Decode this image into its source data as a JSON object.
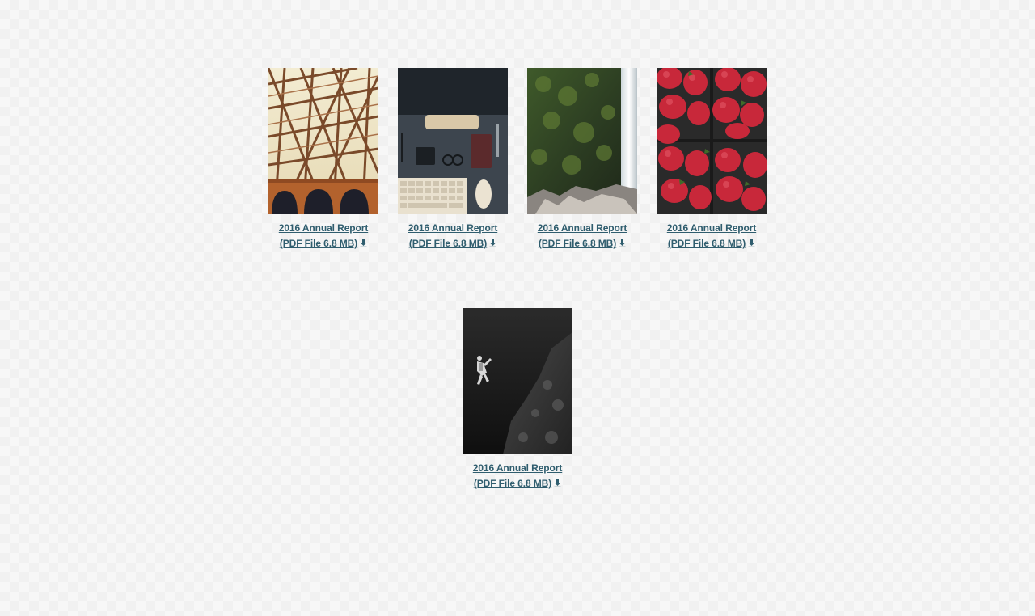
{
  "reports": [
    {
      "line1": "2016 Annual Report",
      "line2": "(PDF File 6.8 MB)",
      "icon": "download-icon",
      "image": "steel-bridge-photo"
    },
    {
      "line1": "2016 Annual Report",
      "line2": "(PDF File 6.8 MB)",
      "icon": "download-icon",
      "image": "desk-keyboard-photo"
    },
    {
      "line1": "2016 Annual Report",
      "line2": "(PDF File 6.8 MB)",
      "icon": "download-icon",
      "image": "waterfall-moss-photo"
    },
    {
      "line1": "2016 Annual Report",
      "line2": "(PDF File 6.8 MB)",
      "icon": "download-icon",
      "image": "strawberries-photo"
    },
    {
      "line1": "2016 Annual Report",
      "line2": "(PDF File 6.8 MB)",
      "icon": "download-icon",
      "image": "scuba-diver-photo"
    }
  ],
  "colors": {
    "link": "#2f5d6e",
    "background": "#f7f7f7"
  }
}
